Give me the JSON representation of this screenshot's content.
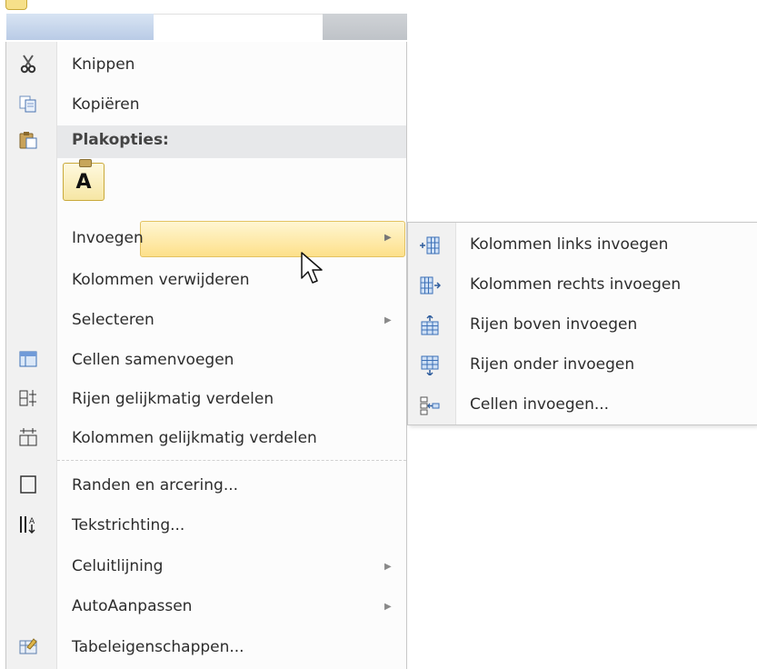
{
  "menu": {
    "items": [
      {
        "label": "Knippen",
        "icon": "scissors-icon"
      },
      {
        "label": "Kopiëren",
        "icon": "copy-icon"
      },
      {
        "label": "Plakopties:",
        "icon": "paste-icon"
      },
      {
        "label": "A",
        "icon": "paste-keep-text-icon"
      },
      {
        "label": "Invoegen",
        "icon": "",
        "submenu": true,
        "highlighted": true
      },
      {
        "label": "Kolommen verwijderen",
        "icon": ""
      },
      {
        "label": "Selecteren",
        "icon": "",
        "submenu": true
      },
      {
        "label": "Cellen samenvoegen",
        "icon": "merge-cells-icon"
      },
      {
        "label": "Rijen gelijkmatig verdelen",
        "icon": "distribute-rows-icon"
      },
      {
        "label": "Kolommen gelijkmatig verdelen",
        "icon": "distribute-columns-icon"
      },
      {
        "label": "Randen en arcering...",
        "icon": "borders-icon"
      },
      {
        "label": "Tekstrichting...",
        "icon": "text-direction-icon"
      },
      {
        "label": "Celuitlijning",
        "icon": "",
        "submenu": true
      },
      {
        "label": "AutoAanpassen",
        "icon": "",
        "submenu": true
      },
      {
        "label": "Tabeleigenschappen...",
        "icon": "table-properties-icon"
      }
    ]
  },
  "submenu": {
    "items": [
      {
        "label": "Kolommen links invoegen",
        "icon": "insert-column-left-icon"
      },
      {
        "label": "Kolommen rechts invoegen",
        "icon": "insert-column-right-icon"
      },
      {
        "label": "Rijen boven invoegen",
        "icon": "insert-row-above-icon"
      },
      {
        "label": "Rijen onder invoegen",
        "icon": "insert-row-below-icon"
      },
      {
        "label": "Cellen invoegen...",
        "icon": "insert-cells-icon"
      }
    ]
  },
  "arrow_glyph": "▶",
  "colors": {
    "highlight_top": "#fff4c8",
    "highlight_bottom": "#fde28a",
    "highlight_border": "#e3c262",
    "gutter": "#f1f1f1",
    "icon_blue": "#3b6fb6"
  }
}
